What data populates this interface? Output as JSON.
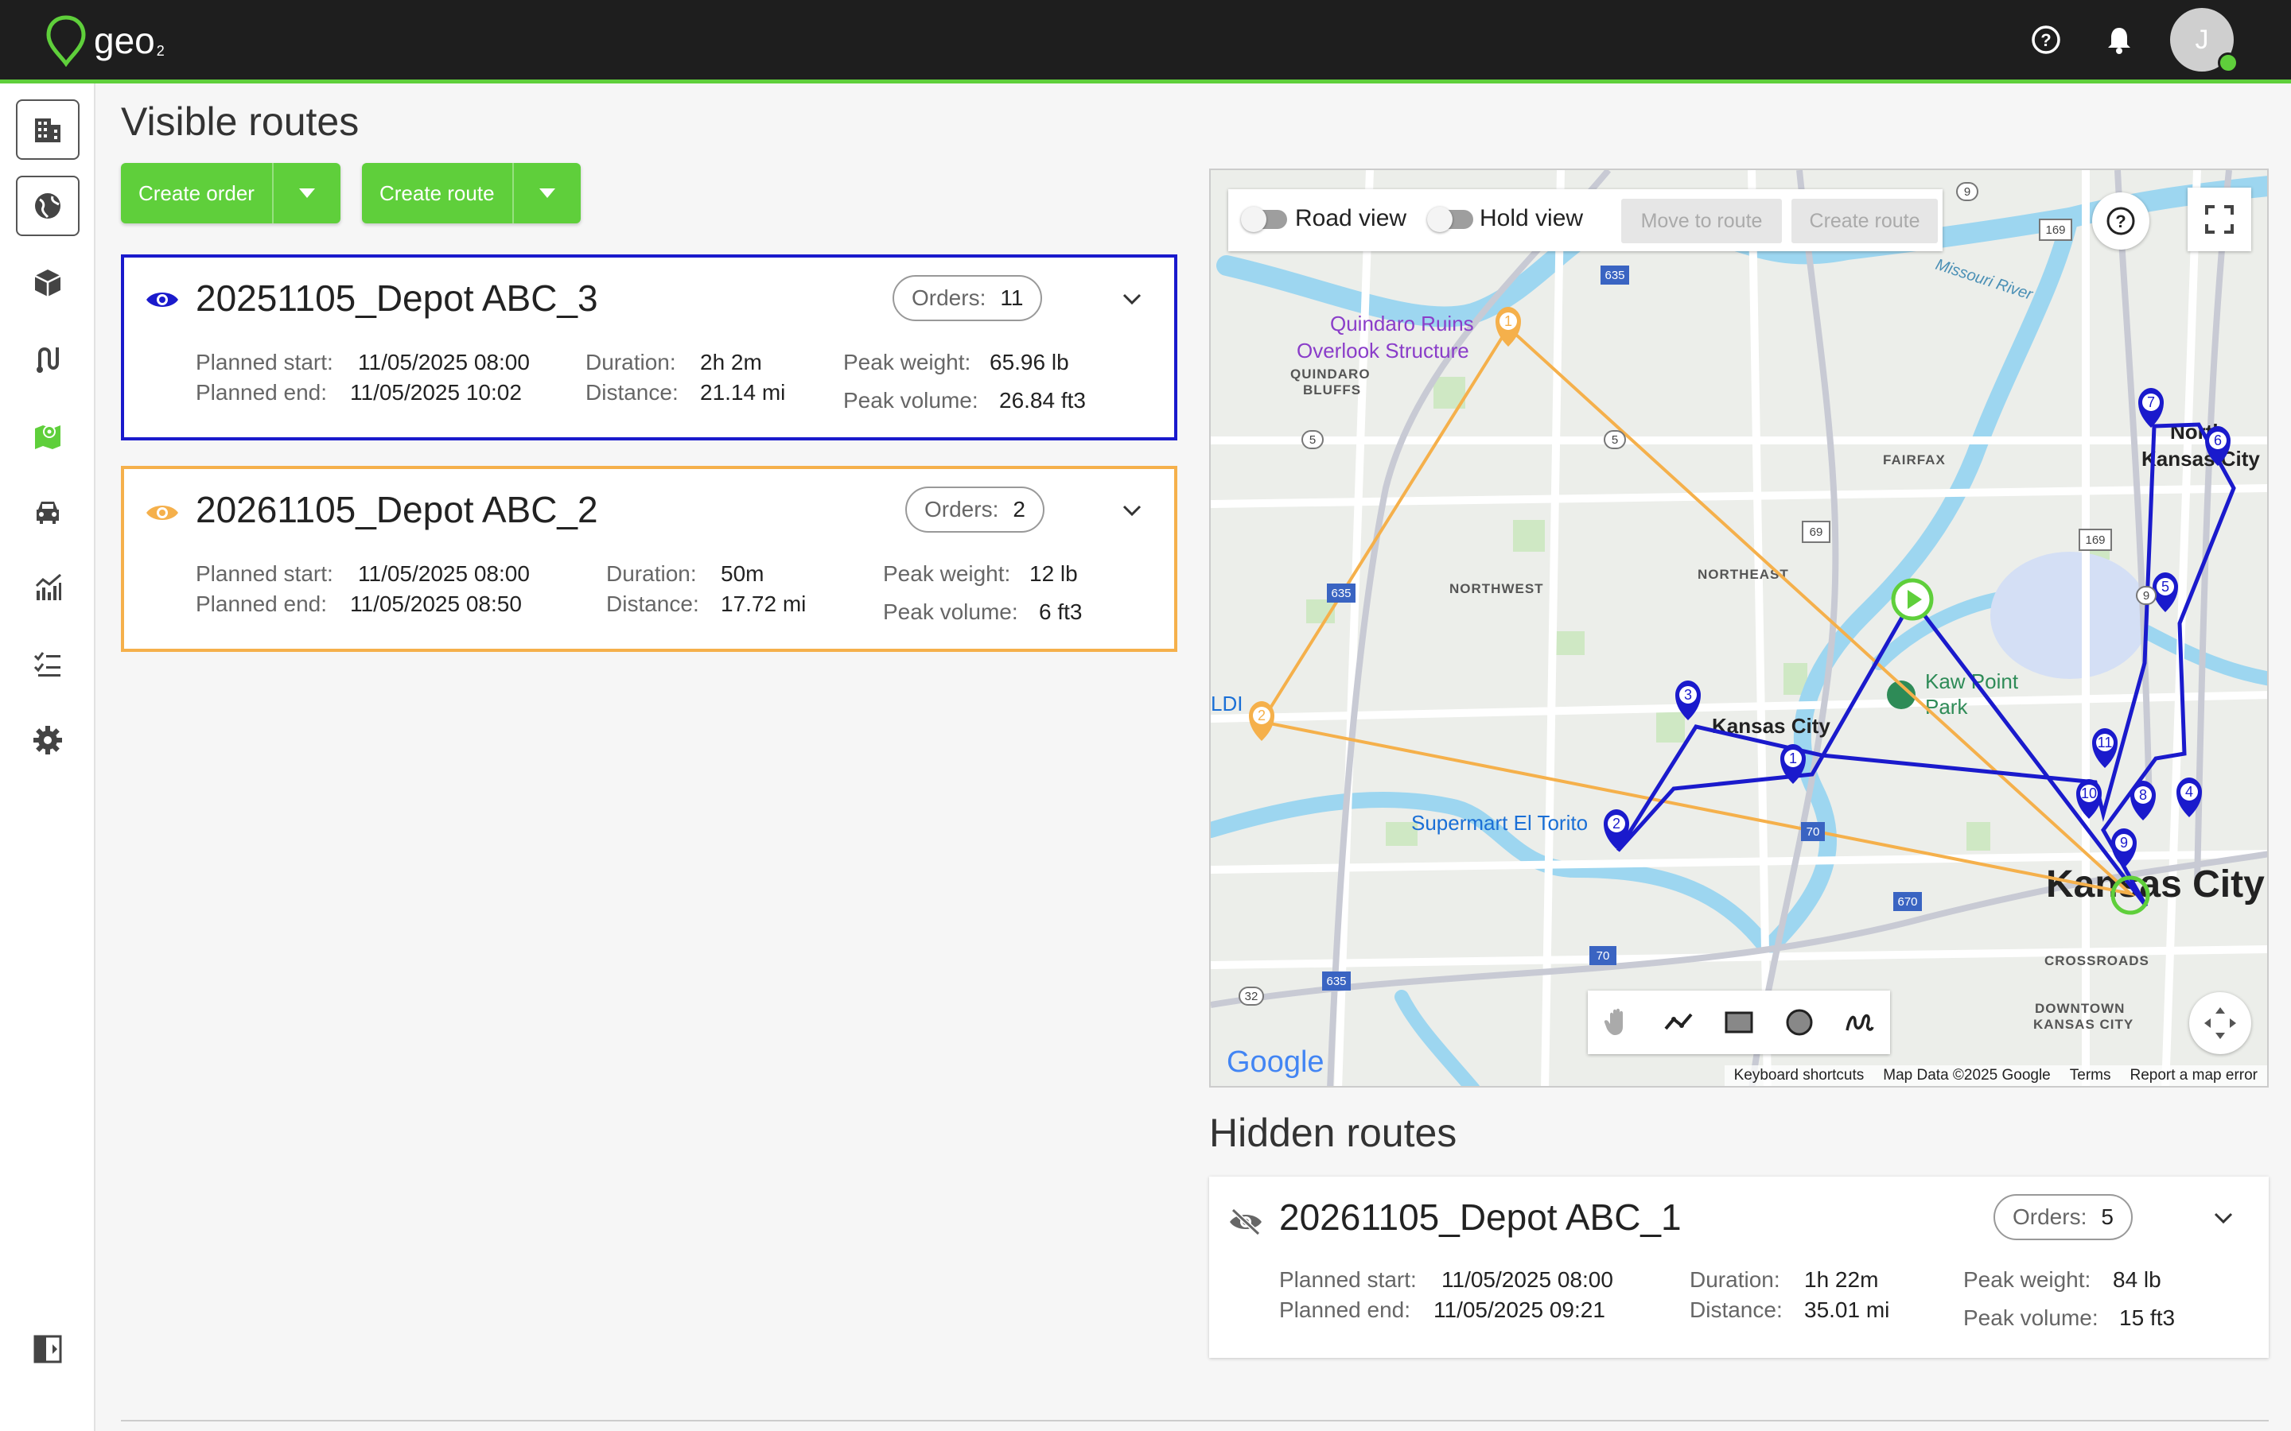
{
  "app": {
    "logo_text": "geo",
    "logo_sub": "2",
    "avatar_initial": "J",
    "brand_color": "#5fcf3b"
  },
  "header": {
    "icons": [
      "help-circle-icon",
      "bell-icon"
    ]
  },
  "sidebar": {
    "items": [
      {
        "name": "building-icon"
      },
      {
        "name": "globe-icon"
      },
      {
        "name": "package-icon"
      },
      {
        "name": "route-icon"
      },
      {
        "name": "map-icon"
      },
      {
        "name": "vehicle-icon"
      },
      {
        "name": "analytics-icon"
      },
      {
        "name": "checklist-icon"
      },
      {
        "name": "gear-icon"
      }
    ],
    "collapse_icon": "sidebar-collapse-icon"
  },
  "page": {
    "visible_title": "Visible routes",
    "hidden_title": "Hidden routes"
  },
  "actions": {
    "create_order": "Create order",
    "create_route": "Create route"
  },
  "labels": {
    "planned_start": "Planned start:",
    "planned_end": "Planned end:",
    "duration": "Duration:",
    "distance": "Distance:",
    "peak_weight": "Peak weight:",
    "peak_volume": "Peak volume:",
    "orders": "Orders:"
  },
  "visible_routes": [
    {
      "name": "20251105_Depot ABC_3",
      "orders": "11",
      "planned_start": "11/05/2025 08:00",
      "planned_end": "11/05/2025 10:02",
      "duration": "2h 2m",
      "distance": "21.14 mi",
      "peak_weight": "65.96 lb",
      "peak_volume": "26.84 ft3",
      "color": "#1a1acc"
    },
    {
      "name": "20261105_Depot ABC_2",
      "orders": "2",
      "planned_start": "11/05/2025 08:00",
      "planned_end": "11/05/2025 08:50",
      "duration": "50m",
      "distance": "17.72 mi",
      "peak_weight": "12 lb",
      "peak_volume": "6 ft3",
      "color": "#f5b04b"
    }
  ],
  "hidden_routes": [
    {
      "name": "20261105_Depot ABC_1",
      "orders": "5",
      "planned_start": "11/05/2025 08:00",
      "planned_end": "11/05/2025 09:21",
      "duration": "1h 22m",
      "distance": "35.01 mi",
      "peak_weight": "84 lb",
      "peak_volume": "15 ft3"
    }
  ],
  "map": {
    "toolbar": {
      "road_view": "Road view",
      "hold_view": "Hold view",
      "move_to_route": "Move to route",
      "create_route": "Create route"
    },
    "labels": {
      "quindaro": "Quindaro Ruins",
      "quindaro2": "Overlook Structure",
      "quindaro_bluffs": "QUINDARO",
      "quindaro_bluffs2": "BLUFFS",
      "fairfax": "FAIRFAX",
      "northwest": "NORTHWEST",
      "northeast": "NORTHEAST",
      "kaw": "Kaw Point",
      "kaw2": "Park",
      "kc": "Kansas City",
      "kc_big": "Kansas City",
      "supermart": "Supermart El Torito",
      "north_kc": "North",
      "north_kc2": "Kansas City",
      "crossroads": "CROSSROADS",
      "downtown": "DOWNTOWN",
      "downtown2": "KANSAS CITY",
      "missouri": "Missouri River",
      "ldi": "LDI"
    },
    "attribution": {
      "shortcuts": "Keyboard shortcuts",
      "data": "Map Data ©2025 Google",
      "terms": "Terms",
      "report": "Report a map error"
    },
    "google": "Google"
  }
}
